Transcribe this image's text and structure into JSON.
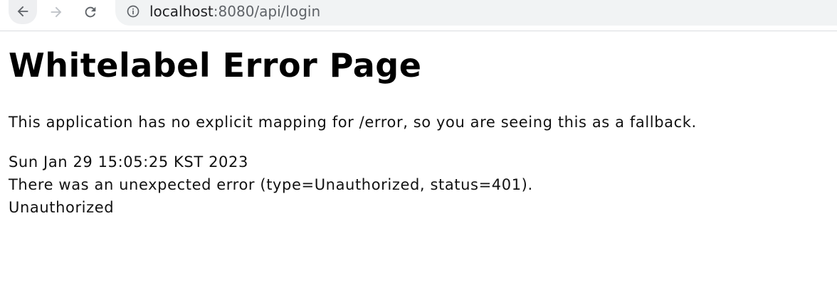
{
  "browser": {
    "url_host": "localhost",
    "url_rest": ":8080/api/login",
    "icons": {
      "back": "arrow-left-icon",
      "forward": "arrow-right-icon",
      "reload": "reload-icon",
      "info": "info-icon"
    }
  },
  "page": {
    "title": "Whitelabel Error Page",
    "message": "This application has no explicit mapping for /error, so you are seeing this as a fallback.",
    "timestamp": "Sun Jan 29 15:05:25 KST 2023",
    "error_line": "There was an unexpected error (type=Unauthorized, status=401).",
    "error_message": "Unauthorized"
  }
}
